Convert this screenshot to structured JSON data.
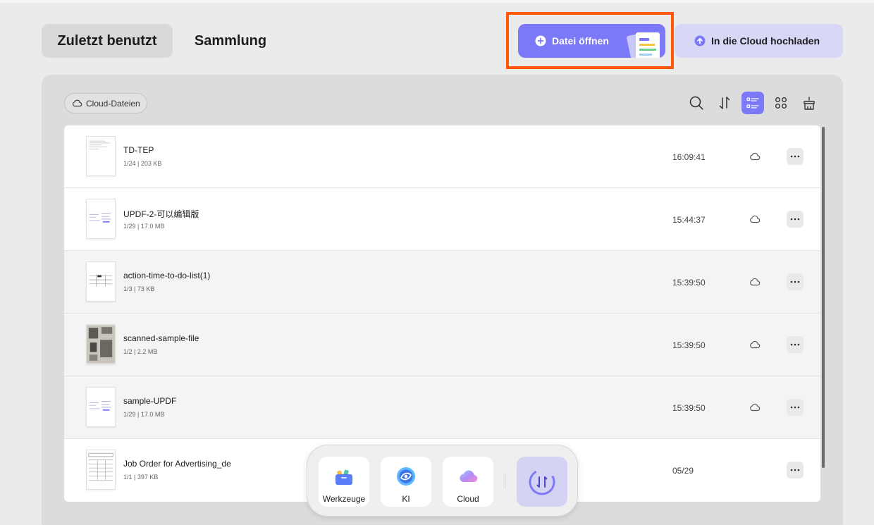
{
  "tabs": {
    "recent": "Zuletzt benutzt",
    "collection": "Sammlung"
  },
  "actions": {
    "open_file": "Datei öffnen",
    "upload_cloud": "In die Cloud hochladen"
  },
  "filter": {
    "cloud_files": "Cloud-Dateien"
  },
  "toolbar_icons": [
    "search-icon",
    "sort-icon",
    "list-view-icon",
    "grid-view-icon",
    "clear-icon"
  ],
  "files": [
    {
      "name": "TD-TEP",
      "meta": "1/24 | 203 KB",
      "time": "16:09:41",
      "cloud": true
    },
    {
      "name": "UPDF-2-可以编辑版",
      "meta": "1/29 | 17.0 MB",
      "time": "15:44:37",
      "cloud": true
    },
    {
      "name": "action-time-to-do-list(1)",
      "meta": "1/3 | 73 KB",
      "time": "15:39:50",
      "cloud": true
    },
    {
      "name": "scanned-sample-file",
      "meta": "1/2 | 2.2 MB",
      "time": "15:39:50",
      "cloud": true
    },
    {
      "name": "sample-UPDF",
      "meta": "1/29 | 17.0 MB",
      "time": "15:39:50",
      "cloud": true
    },
    {
      "name": "Job Order for Advertising_de",
      "meta": "1/1 | 397 KB",
      "time": "05/29",
      "cloud": false
    }
  ],
  "dock": {
    "tools": "Werkzeuge",
    "ai": "KI",
    "cloud": "Cloud"
  },
  "colors": {
    "accent": "#7b79f7",
    "accent_light": "#d8d7f5",
    "highlight": "#ff5a0a",
    "background": "#ebebeb"
  }
}
